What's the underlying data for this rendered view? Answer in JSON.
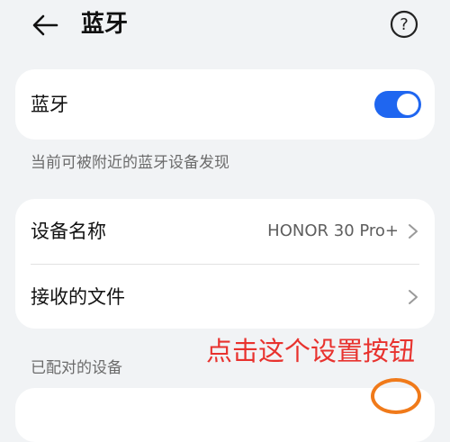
{
  "header": {
    "title": "蓝牙",
    "back_icon": "arrow-left-icon",
    "help_icon": "help-circle-icon",
    "help_glyph": "?"
  },
  "bluetooth": {
    "label": "蓝牙",
    "toggle_on": true,
    "accent_color": "#1f66f0"
  },
  "discoverable_hint": "当前可被附近的蓝牙设备发现",
  "settings": {
    "device_name_label": "设备名称",
    "device_name_value": "HONOR 30 Pro+",
    "received_files_label": "接收的文件"
  },
  "paired_section_label": "已配对的设备",
  "annotation": {
    "text": "点击这个设置按钮",
    "color": "#e8322e"
  }
}
